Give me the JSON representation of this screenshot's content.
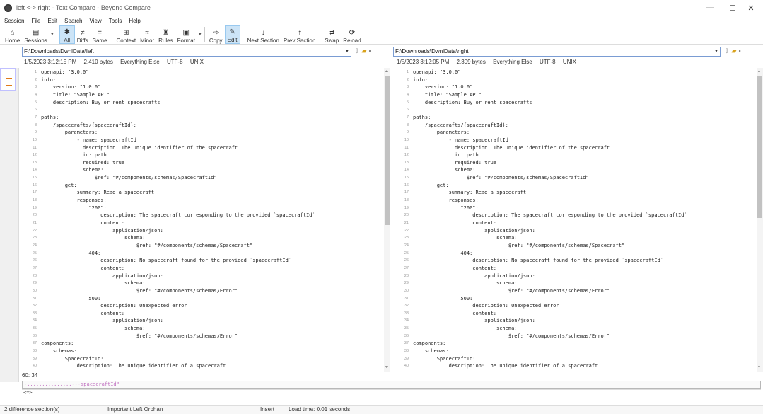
{
  "window": {
    "title": "left <-> right - Text Compare - Beyond Compare",
    "controls": [
      "—",
      "☐",
      "✕"
    ]
  },
  "menu": [
    "Session",
    "File",
    "Edit",
    "Search",
    "View",
    "Tools",
    "Help"
  ],
  "toolbar": [
    {
      "label": "Home",
      "icon": "home-icon",
      "glyph": "⌂"
    },
    {
      "label": "Sessions",
      "icon": "sessions-icon",
      "glyph": "▤",
      "dropdown": true
    },
    {
      "label": "All",
      "icon": "all-filter-icon",
      "glyph": "✱",
      "active": true
    },
    {
      "label": "Diffs",
      "icon": "diffs-filter-icon",
      "glyph": "≠"
    },
    {
      "label": "Same",
      "icon": "same-filter-icon",
      "glyph": "="
    },
    {
      "label": "Context",
      "icon": "context-icon",
      "glyph": "⊞"
    },
    {
      "label": "Minor",
      "icon": "minor-icon",
      "glyph": "≈"
    },
    {
      "label": "Rules",
      "icon": "rules-icon",
      "glyph": "♜"
    },
    {
      "label": "Format",
      "icon": "format-icon",
      "glyph": "▣",
      "dropdown": true
    },
    {
      "label": "Copy",
      "icon": "copy-icon",
      "glyph": "⇨"
    },
    {
      "label": "Edit",
      "icon": "edit-icon",
      "glyph": "✎",
      "active": true
    },
    {
      "label": "Next Section",
      "icon": "next-section-icon",
      "glyph": "↓"
    },
    {
      "label": "Prev Section",
      "icon": "prev-section-icon",
      "glyph": "↑"
    },
    {
      "label": "Swap",
      "icon": "swap-icon",
      "glyph": "⇄"
    },
    {
      "label": "Reload",
      "icon": "reload-icon",
      "glyph": "⟳"
    }
  ],
  "left": {
    "path": "F:\\Downloads\\DwnlData\\left",
    "info": [
      "1/5/2023 3:12:15 PM",
      "2,410 bytes",
      "Everything Else",
      "UTF-8",
      "UNIX"
    ]
  },
  "right": {
    "path": "F:\\Downloads\\DwnlData\\right",
    "info": [
      "1/5/2023 3:12:05 PM",
      "2,309 bytes",
      "Everything Else",
      "UTF-8",
      "UNIX"
    ]
  },
  "left_lines": [
    "openapi: \"3.0.0\"",
    "info:",
    "    version: \"1.0.0\"",
    "    title: \"Sample API\"",
    "    description: Buy or rent spacecrafts",
    "",
    "paths:",
    "    /spacecrafts/{spacecraftId}:",
    "        parameters:",
    "            - name: spacecraftId",
    "              description: The unique identifier of the spacecraft",
    "              in: path",
    "              required: true",
    "              schema:",
    "                  $ref: \"#/components/schemas/SpacecraftId\"",
    "        get:",
    "            summary: Read a spacecraft",
    "            responses:",
    "                \"200\":",
    "                    description: The spacecraft corresponding to the provided `spacecraftId`",
    "                    content:",
    "                        application/json:",
    "                            schema:",
    "                                $ref: \"#/components/schemas/Spacecraft\"",
    "                404:",
    "                    description: No spacecraft found for the provided `spacecraftId`",
    "                    content:",
    "                        application/json:",
    "                            schema:",
    "                                $ref: \"#/components/schemas/Error\"",
    "                500:",
    "                    description: Unexpected error",
    "                    content:",
    "                        application/json:",
    "                            schema:",
    "                                $ref: \"#/components/schemas/Error\"",
    "components:",
    "    schemas:",
    "        SpacecraftId:",
    "            description: The unique identifier of a spacecraft"
  ],
  "right_lines": [
    "openapi: \"3.0.0\"",
    "info:",
    "    version: \"1.0.0\"",
    "    title: \"Sample API\"",
    "    description: Buy or rent spacecrafts",
    "",
    "paths:",
    "    /spacecrafts/{spacecraftId}:",
    "        parameters:",
    "            - name: spacecraftId",
    "              description: The unique identifier of the spacecraft",
    "              in: path",
    "              required: true",
    "              schema:",
    "                  $ref: \"#/components/schemas/SpacecraftId\"",
    "        get:",
    "            summary: Read a spacecraft",
    "            responses:",
    "                \"200\":",
    "                    description: The spacecraft corresponding to the provided `spacecraftId`",
    "                    content:",
    "                        application/json:",
    "                            schema:",
    "                                $ref: \"#/components/schemas/Spacecraft\"",
    "                404:",
    "                    description: No spacecraft found for the provided `spacecraftId`",
    "                    content:",
    "                        application/json:",
    "                            schema:",
    "                                $ref: \"#/components/schemas/Error\"",
    "                500:",
    "                    description: Unexpected error",
    "                    content:",
    "                        application/json:",
    "                            schema:",
    "                                $ref: \"#/components/schemas/Error\"",
    "components:",
    "    schemas:",
    "        SpacecraftId:",
    "            description: The unique identifier of a spacecraft"
  ],
  "cursor_pos": "60: 34",
  "diff_line": "-...............---spacecraftId\"",
  "diff_prefix": "<=>",
  "status": {
    "sections": "2 difference section(s)",
    "orphan": "Important Left Orphan",
    "mode": "Insert",
    "loadtime": "Load time: 0.01 seconds"
  },
  "colors": {
    "accent": "#cce4f7",
    "path_border": "#7a9cd3",
    "diff_marker": "#e07a1a"
  }
}
